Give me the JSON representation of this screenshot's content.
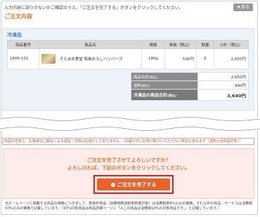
{
  "page": {
    "intro": "入力内容に誤りがないかご確認のうえ、「ご注文を完了する」ボタンをクリックしてください。",
    "back_label": "戻る",
    "section_title": "ご注文内容"
  },
  "cart": {
    "title": "冷凍品",
    "headers": [
      "商品番号",
      "商品名",
      "規格",
      "単価（税込）",
      "数量",
      "小計（税込）"
    ],
    "items": [
      {
        "code": "1600-101",
        "name": "そらまめ食堂 和風おろしハンバーグ",
        "spec": "180g",
        "price": "530円",
        "qty": "5",
        "subtotal": "2,650円"
      }
    ],
    "totals": {
      "product_total_label": "商品合計",
      "product_total_suffix": "(税込)",
      "product_total": "2,650円",
      "shipping_label": "送料",
      "shipping_suffix": "(税込)",
      "shipping": "990円",
      "grand_label": "冷凍品の商品合計",
      "grand_suffix": "(税込)",
      "grand_total": "3,640円"
    }
  },
  "notice": "商品の性質上、お客様のご都合による返品・交換はお受けしておりません。（お届け日にお受け取りいただけない場合も含みます（送料は全商品対象））",
  "confirm": {
    "line1": "ご注文を完了させてよろしいですか？",
    "line2": "よろしければ、下記のボタンをクリックしてください。",
    "button_label": "ご注文を完了する"
  },
  "footer": "当ホームページに掲載する商品の価格につきまして、飲食料商品（消費税軽減税率制度対象）は消費税率8%込みの価格、それ以外の商品・サービスは消費税10%込みの価格で記載しています。（10%対象商品は商品詳細ページに「※この商品は消費税10%の対象商品です。」と記載しています。）",
  "colors": {
    "accent": "#e07a30",
    "button": "#e8622a",
    "highlight": "#e22020",
    "section_blue": "#3a86c8"
  }
}
